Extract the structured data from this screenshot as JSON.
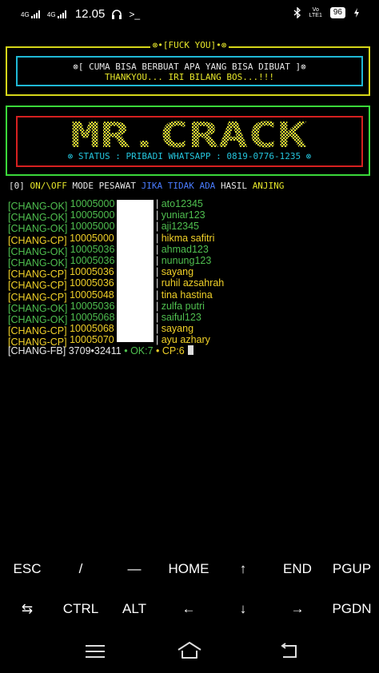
{
  "statusbar": {
    "net1": "4G",
    "net2": "4G",
    "time": "12.05",
    "volte": "Vo\nLTE1",
    "battery": "96"
  },
  "box1": {
    "title": "⊗•[FUCK YOU]•⊗",
    "line1": "⊗[ CUMA BISA BERBUAT APA YANG BISA DIBUAT ]⊗",
    "line2": "THANKYOU... IRI BILANG BOS...!!!"
  },
  "box2": {
    "logo": "MR.CRACK",
    "status": "⊗ STATUS : PRIBADI WHATSAPP : 0819-0776-1235 ⊗"
  },
  "mode": {
    "num": "[0]",
    "onoff": "ON/\\OFF",
    "mode": "MODE PESAWAT",
    "jika": "JIKA TIDAK ADA",
    "hasil": "HASIL",
    "anjing": "ANJING"
  },
  "log": [
    {
      "tag": "[CHANG-OK]",
      "id": "10005000",
      "name": "ato12345",
      "kind": "ok"
    },
    {
      "tag": "[CHANG-OK]",
      "id": "10005000",
      "name": "yuniar123",
      "kind": "ok"
    },
    {
      "tag": "[CHANG-OK]",
      "id": "10005000",
      "name": "aji12345",
      "kind": "ok"
    },
    {
      "tag": "[CHANG-CP]",
      "id": "10005000",
      "name": "hikma safitri",
      "kind": "cp"
    },
    {
      "tag": "[CHANG-OK]",
      "id": "10005036",
      "name": "ahmad123",
      "kind": "ok"
    },
    {
      "tag": "[CHANG-OK]",
      "id": "10005036",
      "name": "nunung123",
      "kind": "ok"
    },
    {
      "tag": "[CHANG-CP]",
      "id": "10005036",
      "name": "sayang",
      "kind": "cp"
    },
    {
      "tag": "[CHANG-CP]",
      "id": "10005036",
      "name": "ruhil azsahrah",
      "kind": "cp"
    },
    {
      "tag": "[CHANG-CP]",
      "id": "10005048",
      "name": "tina hastina",
      "kind": "cp"
    },
    {
      "tag": "[CHANG-OK]",
      "id": "10005036",
      "name": "zulfa putri",
      "kind": "ok"
    },
    {
      "tag": "[CHANG-OK]",
      "id": "10005068",
      "name": "saiful123",
      "kind": "ok"
    },
    {
      "tag": "[CHANG-CP]",
      "id": "10005068",
      "name": "sayang",
      "kind": "cp"
    },
    {
      "tag": "[CHANG-CP]",
      "id": "10005070",
      "name": "ayu azhary",
      "kind": "cp"
    }
  ],
  "summary": {
    "tag": "[CHANG-FB]",
    "progress": "3709•32411",
    "ok": "• OK:7",
    "cp": "• CP:6"
  },
  "keys": {
    "row1": [
      "ESC",
      "/",
      "—",
      "HOME",
      "↑",
      "END",
      "PGUP"
    ],
    "row2": [
      "⇆",
      "CTRL",
      "ALT",
      "←",
      "↓",
      "→",
      "PGDN"
    ]
  },
  "icons": {
    "menu": "menu-icon",
    "home": "home-icon",
    "back": "back-icon"
  }
}
